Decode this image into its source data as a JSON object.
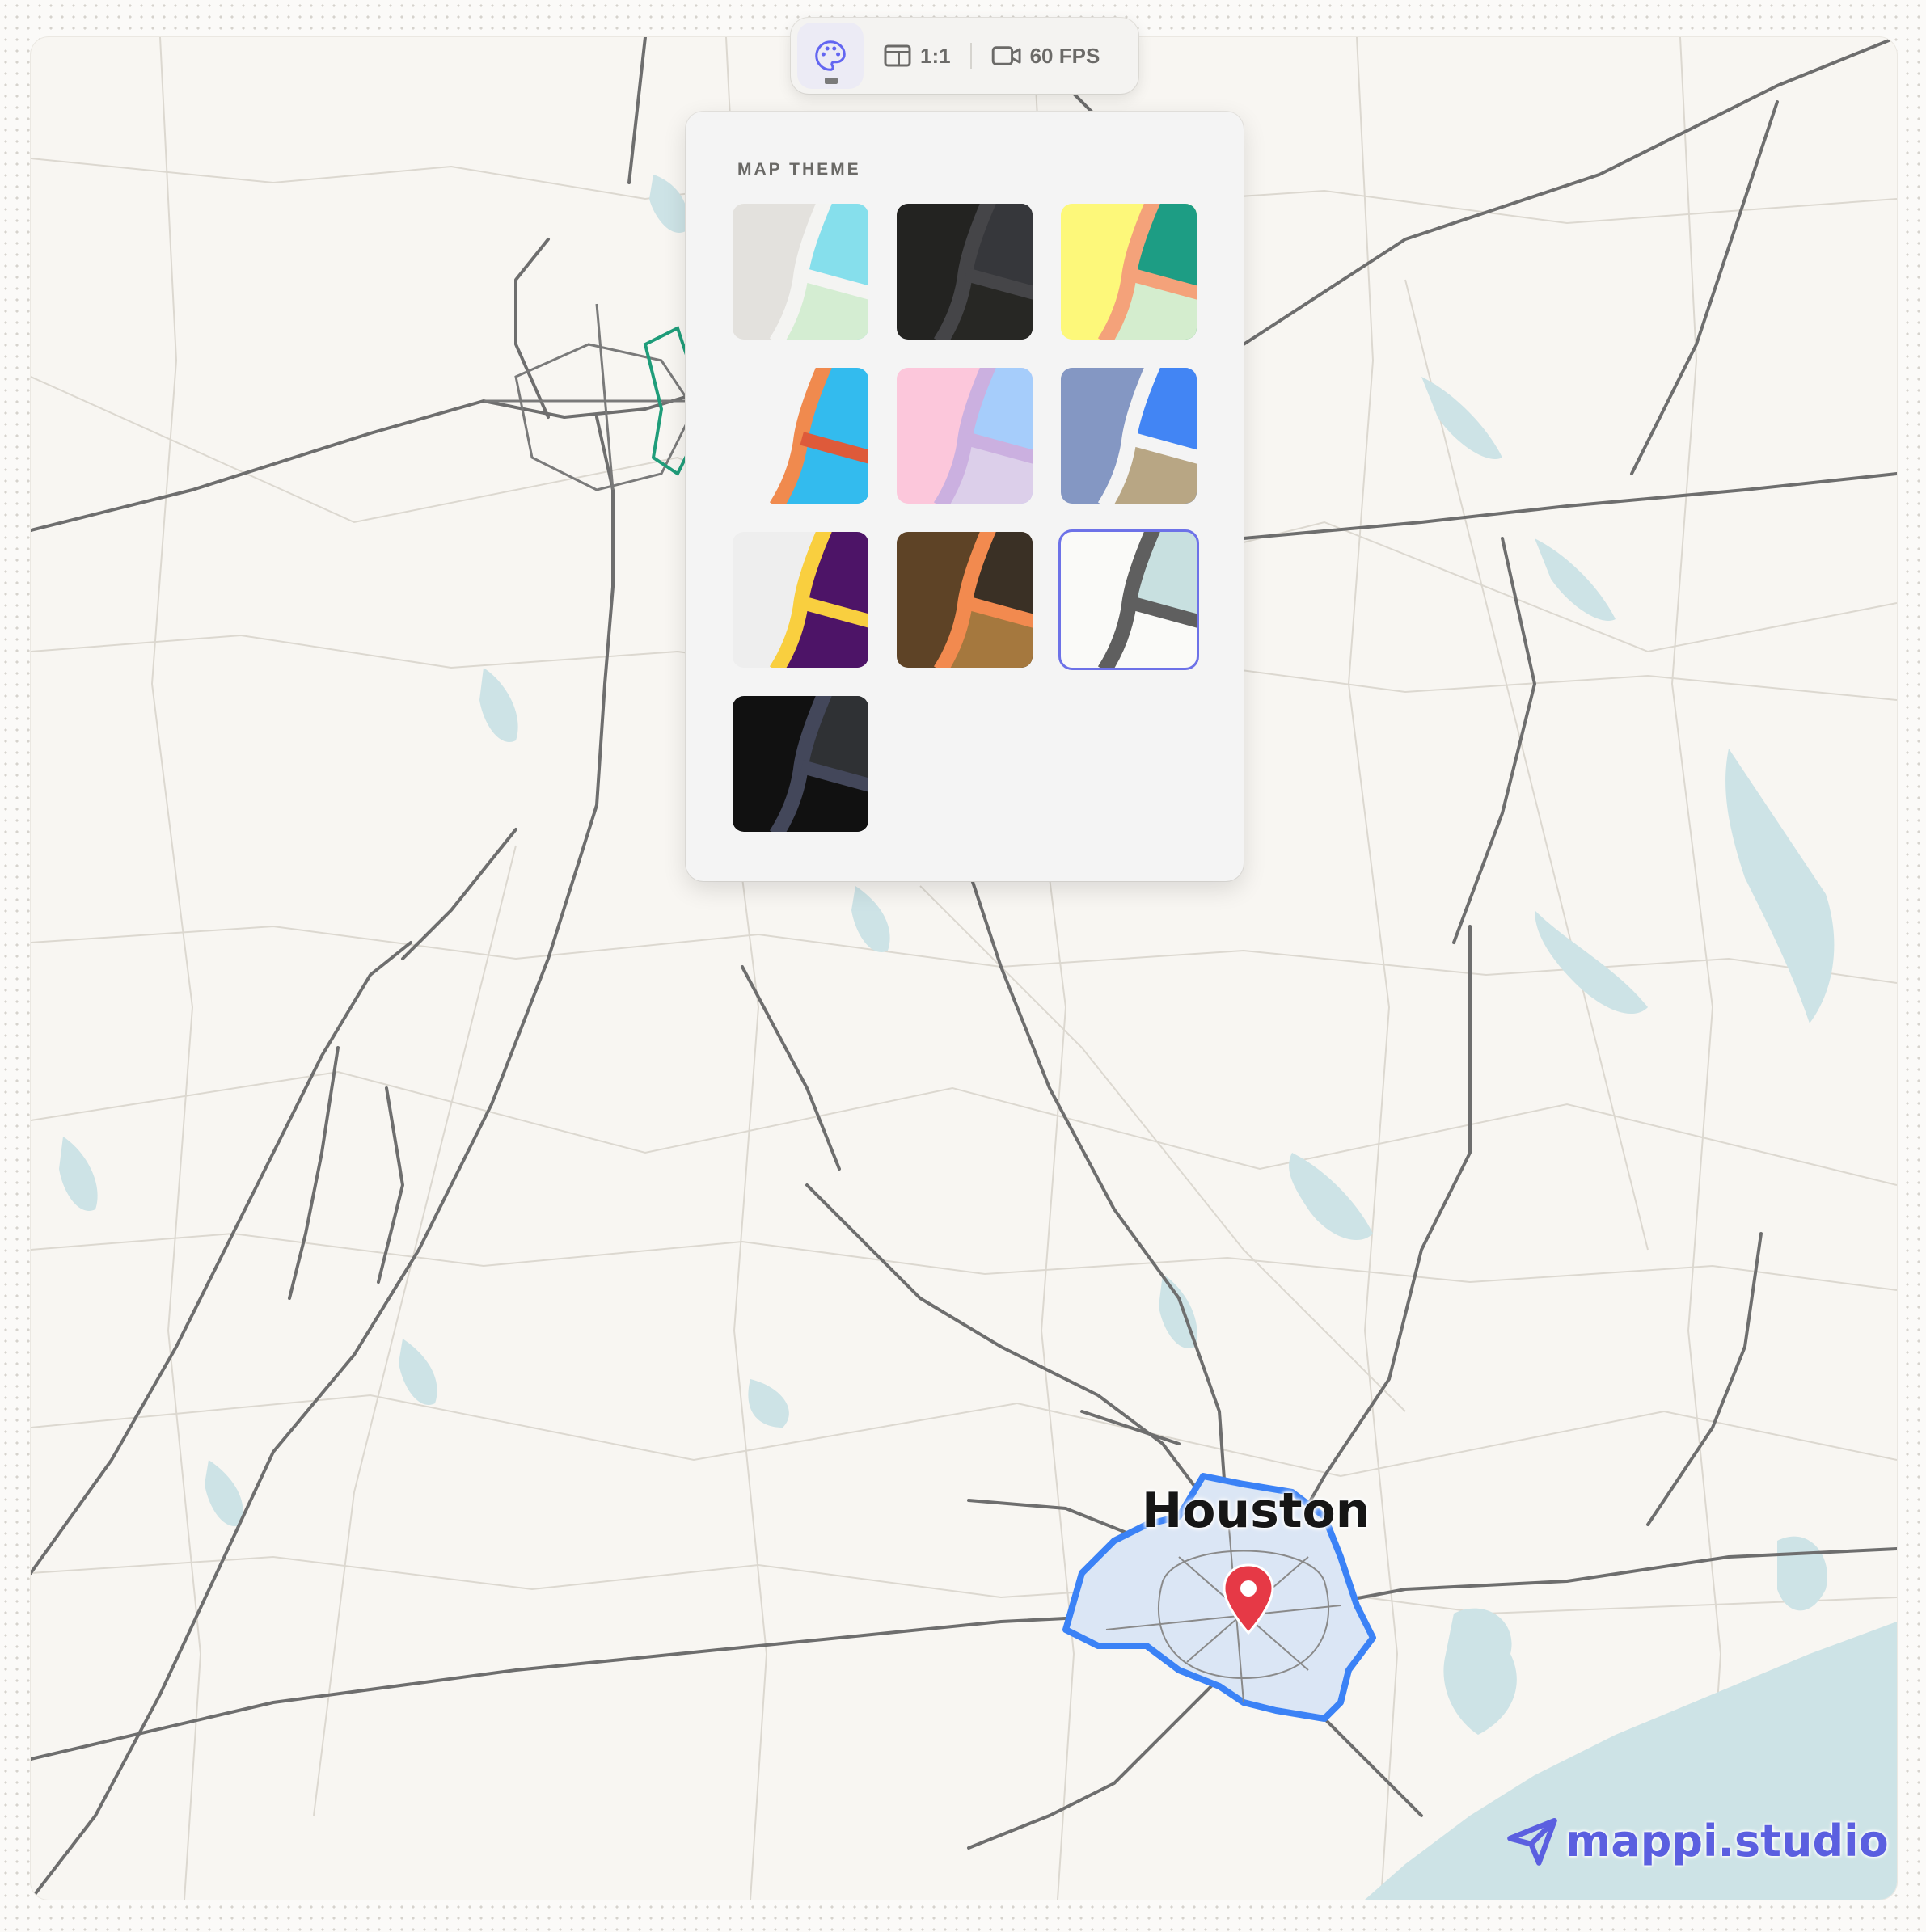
{
  "toolbar": {
    "aspect_label": "1:1",
    "fps_label": "60 FPS"
  },
  "theme_panel": {
    "title": "MAP THEME",
    "themes": [
      {
        "bg": "#e3e1dd",
        "road": "#f4f4f2",
        "casing": "#f4f4f2",
        "top": "#86dfec",
        "bottom": "#d4edd2",
        "selected": false
      },
      {
        "bg": "#232321",
        "road": "#454548",
        "casing": "#454548",
        "top": "#36373b",
        "bottom": "#272724",
        "selected": false
      },
      {
        "bg": "#fdf87a",
        "road": "#f4a27a",
        "casing": "#f4a27a",
        "top": "#1d9d84",
        "bottom": "#d4edce",
        "selected": false
      },
      {
        "bg": "#f4f4f4",
        "road": "#de5a3a",
        "casing": "#f08a4e",
        "top": "#33bbee",
        "bottom": "#33bbee",
        "selected": false
      },
      {
        "bg": "#fcc7db",
        "road": "#cbb0e0",
        "casing": "#cbb0e0",
        "top": "#a6cdfb",
        "bottom": "#dccfea",
        "selected": false
      },
      {
        "bg": "#8497c3",
        "road": "#f4f4f4",
        "casing": "#f4f4f4",
        "top": "#4285f4",
        "bottom": "#b8a684",
        "selected": false
      },
      {
        "bg": "#eeeeee",
        "road": "#f9cf3f",
        "casing": "#f9cf3f",
        "top": "#4d1467",
        "bottom": "#4d1467",
        "selected": false
      },
      {
        "bg": "#5e4326",
        "road": "#f28a4f",
        "casing": "#f28a4f",
        "top": "#3a3025",
        "bottom": "#a5783e",
        "selected": false
      },
      {
        "bg": "#fafaf8",
        "road": "#5f5f5f",
        "casing": "#5f5f5f",
        "top": "#c8e0e0",
        "bottom": "#fafaf8",
        "selected": true
      },
      {
        "bg": "#111111",
        "road": "#43475a",
        "casing": "#43475a",
        "top": "#2f3134",
        "bottom": "#111111",
        "selected": false
      }
    ]
  },
  "map": {
    "city_label": "Houston",
    "marker_color": "#e63946",
    "water_color": "#cde3e6",
    "highway_color": "#6e6e6e",
    "minor_road_color": "#dcd8d0",
    "highlight_color": "#3b82f6",
    "highlight_fill": "#dbe6f5",
    "dallas_outline_color": "#1f9d7a"
  },
  "brand": {
    "text": "mappi.studio",
    "color": "#5b5fe0"
  }
}
